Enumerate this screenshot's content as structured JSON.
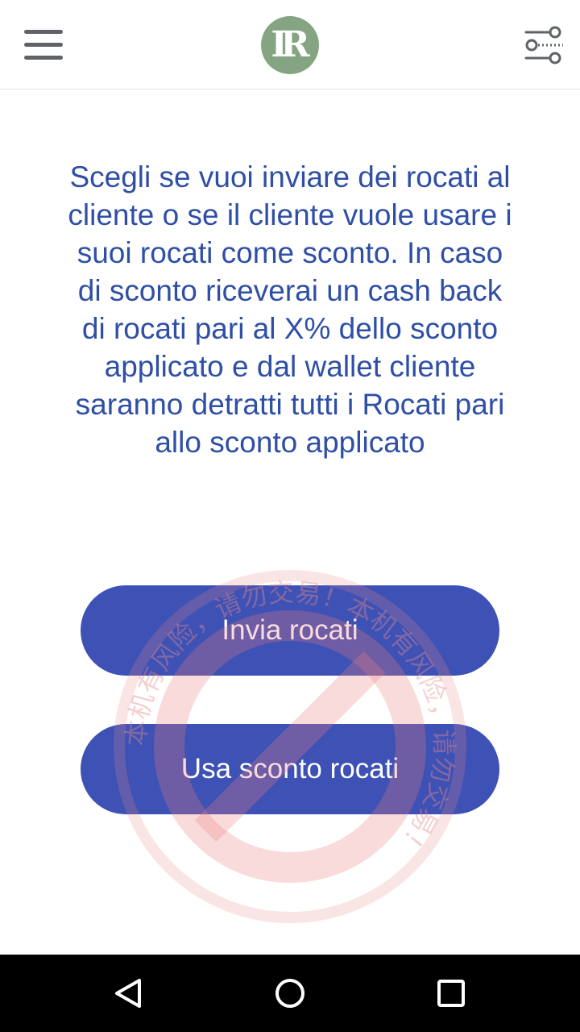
{
  "app_bar": {
    "menu_icon": "hamburger-menu-icon",
    "logo_text": "IR",
    "logo_color": "#85a582",
    "filter_icon": "filter-sliders-icon"
  },
  "main": {
    "description": "Scegli se vuoi inviare dei rocati al cliente o se il cliente vuole usare i suoi rocati come sconto. In caso di sconto riceverai un cash back di rocati pari al X% dello sconto applicato e dal wallet cliente saranno detratti tutti i Rocati pari allo sconto applicato",
    "text_color": "#2f4fa6",
    "buttons": [
      {
        "label": "Invia rocati"
      },
      {
        "label": "Usa sconto rocati"
      }
    ],
    "button_color": "#3e51b5"
  },
  "watermark": {
    "text": "本机有风险，请勿交易！本机有风险，请勿交易！",
    "color": "#e88a8a"
  },
  "nav_bar": {
    "back_icon": "back-triangle-icon",
    "home_icon": "home-circle-icon",
    "recents_icon": "recents-square-icon"
  }
}
